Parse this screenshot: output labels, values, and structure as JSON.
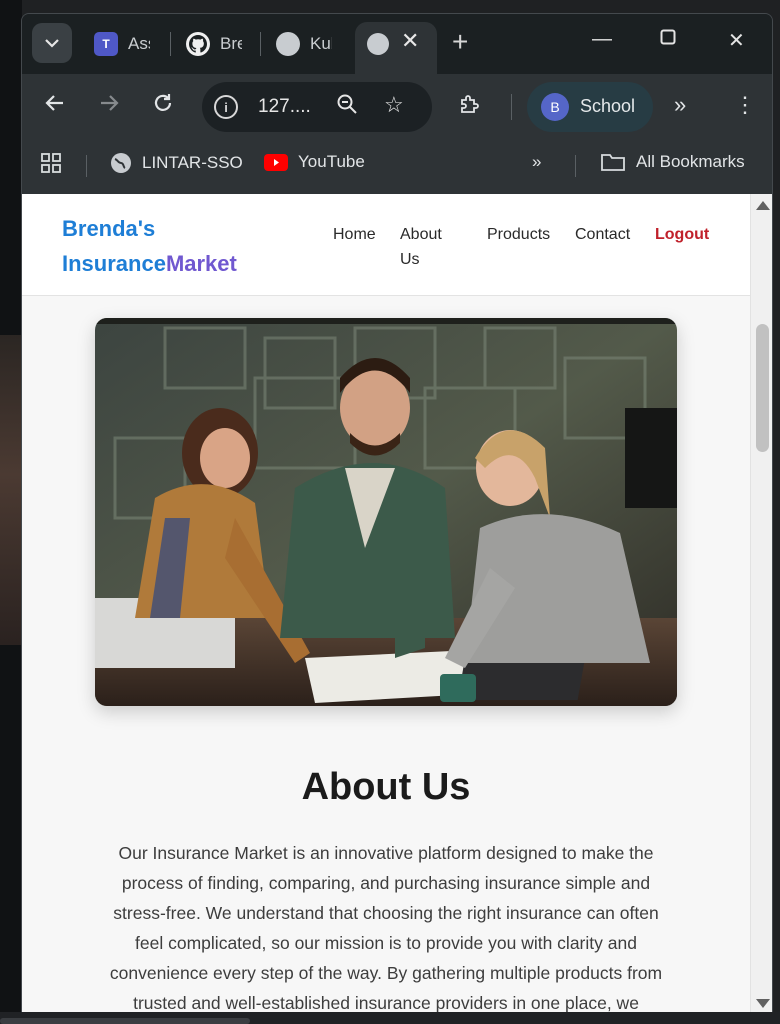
{
  "browser": {
    "tabs": [
      {
        "title": "Assignment",
        "favicon": "teams-icon"
      },
      {
        "title": "Brenda",
        "favicon": "github-icon"
      },
      {
        "title": "Kubernetes",
        "favicon": "globe-icon"
      },
      {
        "title": "",
        "favicon": "globe-icon",
        "active": true
      }
    ],
    "url": "127....",
    "profile": {
      "initial": "B",
      "name": "School"
    },
    "bookmarks": [
      {
        "label": "LINTAR-SSO",
        "icon": "globe-icon"
      },
      {
        "label": "YouTube",
        "icon": "youtube-icon"
      }
    ],
    "all_bookmarks_label": "All Bookmarks",
    "colors": {
      "accent": "#5566c8",
      "youtube": "#ff0000"
    }
  },
  "site": {
    "brand": {
      "line1": "Brenda's",
      "part_a": "Insurance",
      "part_b": "Market"
    },
    "nav": [
      {
        "label": "Home"
      },
      {
        "label": "About Us"
      },
      {
        "label": "Products"
      },
      {
        "label": "Contact"
      },
      {
        "label": "Logout"
      }
    ],
    "hero_alt": "team-photo",
    "about": {
      "title": "About Us",
      "text": "Our Insurance Market is an innovative platform designed to make the process of finding, comparing, and purchasing insurance simple and stress-free. We understand that choosing the right insurance can often feel complicated, so our mission is to provide you with clarity and convenience every step of the way. By gathering multiple products from trusted and well-established insurance providers in one place, we"
    },
    "colors": {
      "brand_blue": "#1e7ed6",
      "brand_purple": "#7058d0",
      "logout_red": "#c0212b"
    }
  }
}
